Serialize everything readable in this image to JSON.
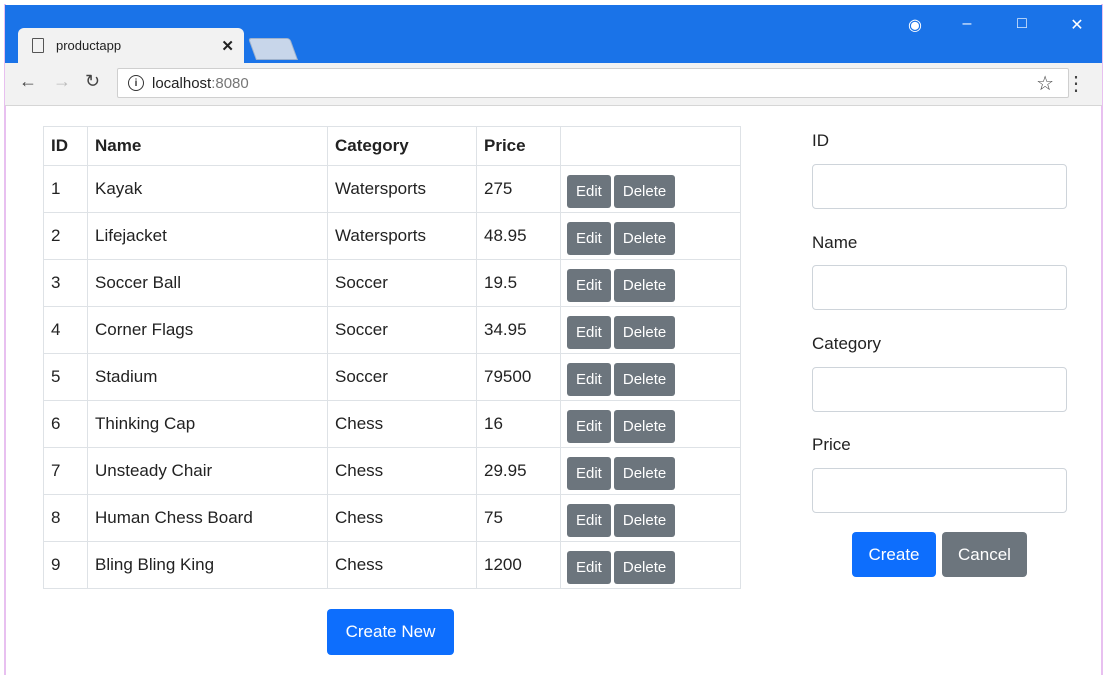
{
  "browser": {
    "tab_title": "productapp",
    "url_host": "localhost",
    "url_port": ":8080"
  },
  "table": {
    "headers": [
      "ID",
      "Name",
      "Category",
      "Price"
    ],
    "rows": [
      {
        "id": "1",
        "name": "Kayak",
        "category": "Watersports",
        "price": "275"
      },
      {
        "id": "2",
        "name": "Lifejacket",
        "category": "Watersports",
        "price": "48.95"
      },
      {
        "id": "3",
        "name": "Soccer Ball",
        "category": "Soccer",
        "price": "19.5"
      },
      {
        "id": "4",
        "name": "Corner Flags",
        "category": "Soccer",
        "price": "34.95"
      },
      {
        "id": "5",
        "name": "Stadium",
        "category": "Soccer",
        "price": "79500"
      },
      {
        "id": "6",
        "name": "Thinking Cap",
        "category": "Chess",
        "price": "16"
      },
      {
        "id": "7",
        "name": "Unsteady Chair",
        "category": "Chess",
        "price": "29.95"
      },
      {
        "id": "8",
        "name": "Human Chess Board",
        "category": "Chess",
        "price": "75"
      },
      {
        "id": "9",
        "name": "Bling Bling King",
        "category": "Chess",
        "price": "1200"
      }
    ],
    "edit_label": "Edit",
    "delete_label": "Delete",
    "create_new_label": "Create New"
  },
  "form": {
    "id_label": "ID",
    "name_label": "Name",
    "category_label": "Category",
    "price_label": "Price",
    "create_label": "Create",
    "cancel_label": "Cancel"
  },
  "colors": {
    "titlebar": "#1a73e8",
    "primary": "#0d6efd",
    "secondary": "#6c757d"
  }
}
